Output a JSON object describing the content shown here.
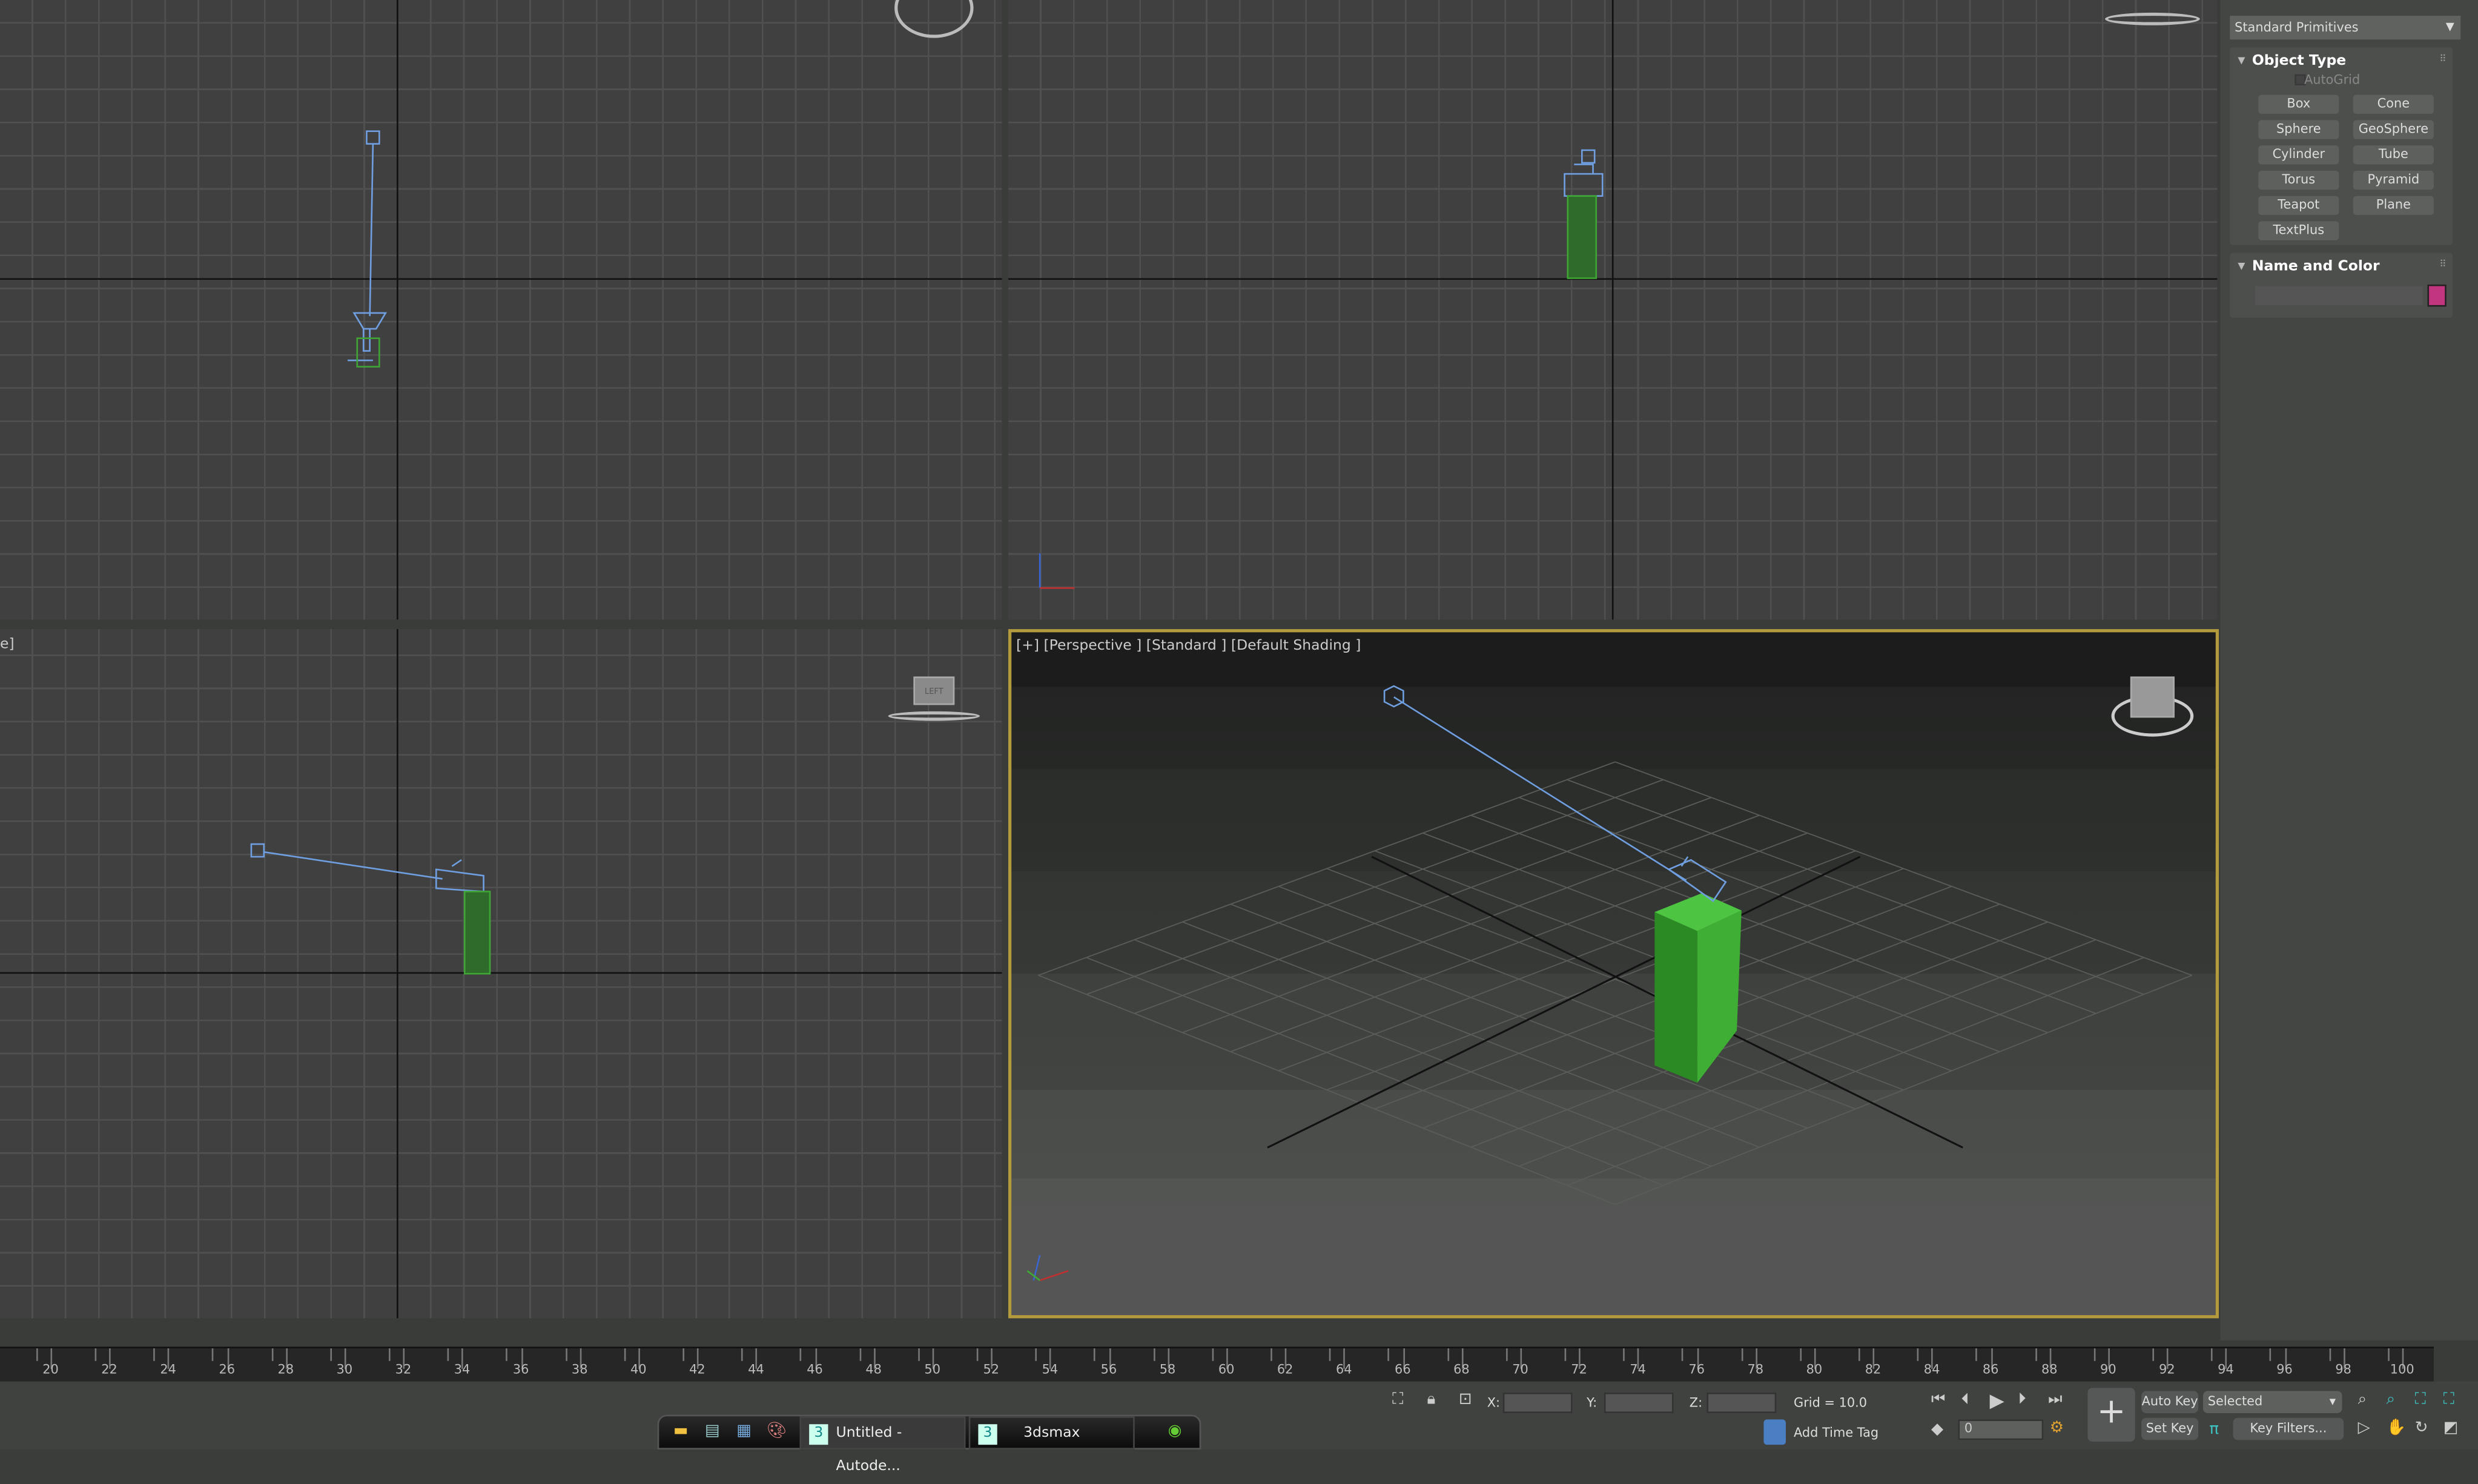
{
  "viewports": {
    "top_left": {
      "label": ""
    },
    "bottom_left": {
      "label_fragment": "e]"
    },
    "perspective": {
      "label": "[+] [Perspective ] [Standard ] [Default Shading ]"
    },
    "cube_label": "LEFT"
  },
  "command_panel": {
    "category_dropdown": "Standard Primitives",
    "object_type": {
      "title": "Object Type",
      "autogrid_label": "AutoGrid",
      "autogrid_checked": false,
      "buttons": [
        "Box",
        "Cone",
        "Sphere",
        "GeoSphere",
        "Cylinder",
        "Tube",
        "Torus",
        "Pyramid",
        "Teapot",
        "Plane",
        "TextPlus"
      ]
    },
    "name_and_color": {
      "title": "Name and Color",
      "name_value": "",
      "color": "#c2357f"
    }
  },
  "timeline": {
    "labels": [
      "20",
      "22",
      "24",
      "26",
      "28",
      "30",
      "32",
      "34",
      "36",
      "38",
      "40",
      "42",
      "44",
      "46",
      "48",
      "50",
      "52",
      "54",
      "56",
      "58",
      "60",
      "62",
      "64",
      "66",
      "68",
      "70",
      "72",
      "74",
      "76",
      "78",
      "80",
      "82",
      "84",
      "86",
      "88",
      "90",
      "92",
      "94",
      "96",
      "98",
      "100"
    ]
  },
  "status": {
    "x_label": "X:",
    "y_label": "Y:",
    "z_label": "Z:",
    "x_value": "",
    "y_value": "",
    "z_value": "",
    "grid": "Grid = 10.0",
    "add_time_tag": "Add Time Tag",
    "current_frame": "0",
    "auto_key": "Auto Key",
    "set_key": "Set Key",
    "selection_dropdown": "Selected",
    "key_filters": "Key Filters..."
  },
  "taskbar": {
    "items": [
      {
        "label": "Untitled - Autode...",
        "active": true
      },
      {
        "label": "3dsmax",
        "active": false
      }
    ]
  },
  "colors": {
    "active_viewport_border": "#b39a3c",
    "box": "#3fa535",
    "camera": "#6f9fe0",
    "object_color": "#c2357f"
  }
}
